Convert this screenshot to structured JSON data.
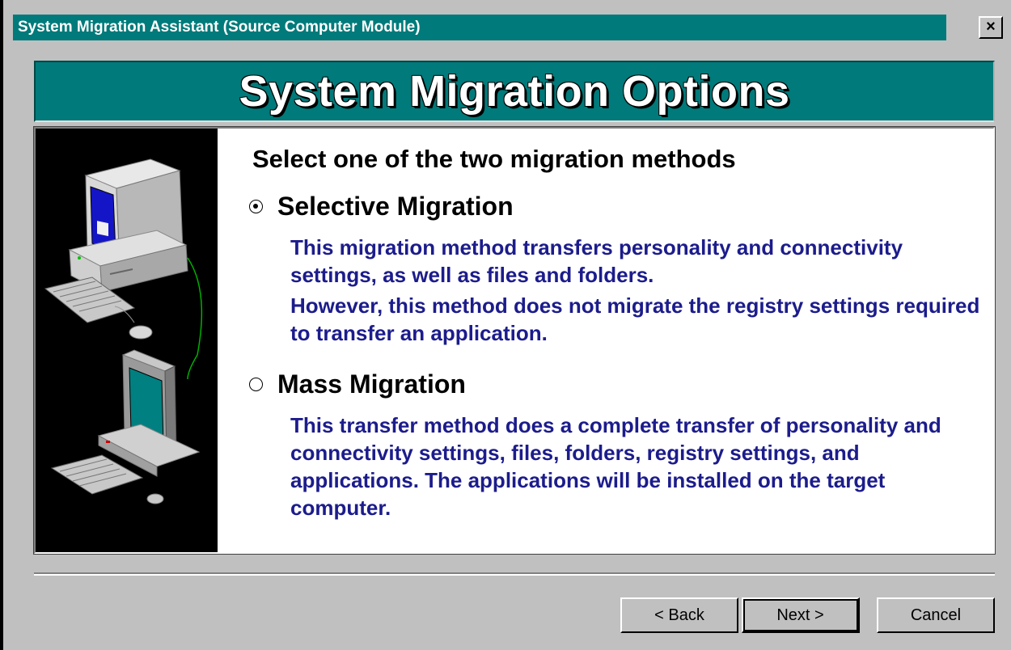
{
  "window": {
    "title": "System Migration Assistant (Source Computer Module)",
    "close_icon": "close-x-icon",
    "close_label": "×"
  },
  "banner": {
    "title": "System Migration Options"
  },
  "content": {
    "heading": "Select one of the two migration methods",
    "illustration": "two-computers-connected-by-cable",
    "options": [
      {
        "label": "Selective Migration",
        "selected": true,
        "description": [
          "This migration method transfers personality and connectivity settings, as well as files and folders.",
          "However, this method does not migrate the registry settings required to transfer an application."
        ]
      },
      {
        "label": "Mass Migration",
        "selected": false,
        "description": [
          "This transfer method does a complete transfer of personality and connectivity settings, files, folders, registry settings, and applications.  The applications will be installed on the target computer."
        ]
      }
    ]
  },
  "buttons": {
    "back": "< Back",
    "next": "Next >",
    "cancel": "Cancel"
  },
  "colors": {
    "title_bar": "#007a7a",
    "description_text": "#1c1c8c",
    "dialog_background": "#c0c0c0"
  }
}
